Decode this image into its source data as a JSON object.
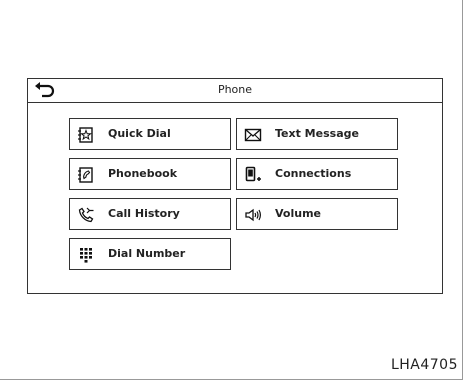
{
  "header": {
    "title": "Phone",
    "back_icon": "back-arrow-icon"
  },
  "menu": {
    "items": [
      {
        "label": "Quick Dial",
        "icon": "star-list-icon"
      },
      {
        "label": "Text Message",
        "icon": "envelope-icon"
      },
      {
        "label": "Phonebook",
        "icon": "phonebook-icon"
      },
      {
        "label": "Connections",
        "icon": "phone-connect-icon"
      },
      {
        "label": "Call History",
        "icon": "call-history-icon"
      },
      {
        "label": "Volume",
        "icon": "speaker-icon"
      },
      {
        "label": "Dial Number",
        "icon": "keypad-icon"
      }
    ]
  },
  "figure_code": "LHA4705"
}
